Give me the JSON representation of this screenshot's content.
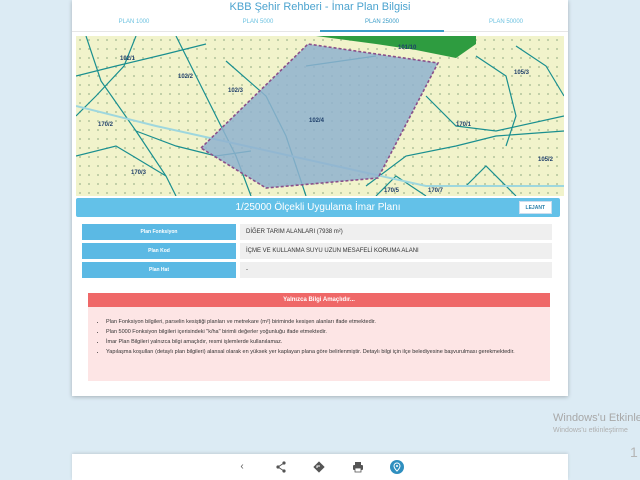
{
  "header": {
    "title": "KBB Şehir Rehberi - İmar Plan Bilgisi"
  },
  "tabs": [
    {
      "label": "PLAN 1000"
    },
    {
      "label": "PLAN 5000"
    },
    {
      "label": "PLAN 25000"
    },
    {
      "label": "PLAN 50000"
    }
  ],
  "map": {
    "labels": [
      "102/1",
      "102/2",
      "102/3",
      "102/4",
      "105/3",
      "170/1",
      "170/2",
      "170/3",
      "170/5",
      "170/7",
      "105/2",
      "101/10"
    ],
    "colors": {
      "farmland": "#f1f3cb",
      "parcel": "#8fb1cf",
      "forest": "#2e9c40",
      "road": "#1a8f8f"
    }
  },
  "scale": {
    "title": "1/25000 Ölçekli Uygulama İmar Planı",
    "legend_button": "LEJANT"
  },
  "info": [
    {
      "label": "Plan Fonksiyon",
      "value": "DİĞER TARIM ALANLARI (7938 m²)"
    },
    {
      "label": "Plan Kod",
      "value": "İÇME VE KULLANMA SUYU UZUN MESAFELİ KORUMA ALANI"
    },
    {
      "label": "Plan Hat",
      "value": "-"
    }
  ],
  "notice": {
    "title": "Yalnızca Bilgi Amaçlıdır...",
    "items": [
      "Plan Fonksiyon bilgileri, parselin kesiştiği planları ve metrekare (m²) biriminde kesişen alanları ifade etmektedir.",
      "Plan 5000 Fonksiyon bilgileri içerisindeki \"k/ha\" birimli değerler yoğunluğu ifade etmektedir.",
      "İmar Plan Bilgileri yalnızca bilgi amaçlıdır, resmi işlemlerde kullanılamaz.",
      "Yapılaşma koşulları (detaylı plan bilgileri) alansal olarak en yüksek yer kaplayan plana göre belirlenmiştir. Detaylı bilgi için ilçe belediyesine başvurulması gerekmektedir."
    ]
  },
  "bottom_nav": {
    "icons": [
      "back-icon",
      "share-icon",
      "directions-icon",
      "print-icon",
      "map-pin-icon"
    ]
  },
  "watermark": {
    "title": "Windows'u Etkinle",
    "subtitle": "Windows'u etkinleştirme",
    "number": "1"
  }
}
